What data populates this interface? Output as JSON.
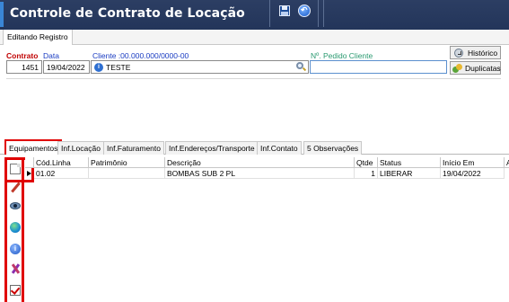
{
  "window": {
    "title": "Controle de Contrato de Locação",
    "toolbar": {
      "save_icon": "save-icon",
      "back_icon": "back-icon"
    }
  },
  "editing_tab": {
    "label": "Editando Registro"
  },
  "form": {
    "contrato": {
      "label": "Contrato",
      "value": "1451"
    },
    "data": {
      "label": "Data",
      "value": "19/04/2022"
    },
    "cliente": {
      "label": "Cliente :00.000.000/0000-00",
      "value": "TESTE"
    },
    "pedido_cliente": {
      "label": "Nº. Pedido Cliente",
      "value": ""
    },
    "historico_button": "Histórico",
    "duplicatas_button": "Duplicatas"
  },
  "tabs": [
    {
      "label": "Equipamentos",
      "active": true
    },
    {
      "label": "Inf.Locação"
    },
    {
      "label": "Inf.Faturamento"
    },
    {
      "label": "Inf.Endereços/Transporte"
    },
    {
      "label": "Inf.Contato"
    },
    {
      "label": "5 Observações"
    }
  ],
  "left_toolbar": [
    "new-document-icon",
    "edit-pencil-icon",
    "view-eye-icon",
    "globe-icon",
    "info-icon",
    "tools-icon",
    "approve-check-icon"
  ],
  "grid": {
    "columns": [
      "Cód.Linha",
      "Patrimônio",
      "Descrição",
      "Qtde",
      "Status",
      "Início Em",
      "A"
    ],
    "rows": [
      {
        "cod_linha": "01.02",
        "patrimonio": "",
        "descricao": "BOMBAS SUB 2 PL",
        "qtde": "1",
        "status": "LIBERAR",
        "inicio_em": "19/04/2022"
      }
    ]
  },
  "colors": {
    "titlebar": "#2c3e63",
    "highlight": "#e00000",
    "contrato_label": "#c00000",
    "link_label": "#1a3cc2",
    "pedido_label": "#2a9a70"
  }
}
